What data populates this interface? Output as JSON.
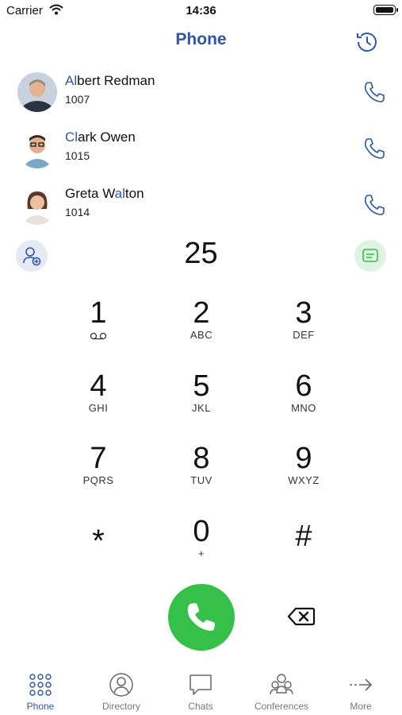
{
  "status": {
    "carrier": "Carrier",
    "time": "14:36"
  },
  "header": {
    "title": "Phone"
  },
  "contacts": [
    {
      "pre": "",
      "hl": "Al",
      "post": "bert Redman",
      "ext": "1007"
    },
    {
      "pre": "",
      "hl": "Cl",
      "post": "ark Owen",
      "ext": "1015"
    },
    {
      "pre": "Greta W",
      "hl": "al",
      "post": "ton",
      "ext": "1014"
    }
  ],
  "dialer": {
    "number": "25"
  },
  "keypad": [
    {
      "digit": "1",
      "letters": ""
    },
    {
      "digit": "2",
      "letters": "ABC"
    },
    {
      "digit": "3",
      "letters": "DEF"
    },
    {
      "digit": "4",
      "letters": "GHI"
    },
    {
      "digit": "5",
      "letters": "JKL"
    },
    {
      "digit": "6",
      "letters": "MNO"
    },
    {
      "digit": "7",
      "letters": "PQRS"
    },
    {
      "digit": "8",
      "letters": "TUV"
    },
    {
      "digit": "9",
      "letters": "WXYZ"
    },
    {
      "digit": "*",
      "letters": ""
    },
    {
      "digit": "0",
      "letters": "+"
    },
    {
      "digit": "#",
      "letters": ""
    }
  ],
  "tabs": [
    {
      "label": "Phone",
      "icon": "keypad-grid-icon"
    },
    {
      "label": "Directory",
      "icon": "person-circle-icon"
    },
    {
      "label": "Chats",
      "icon": "chat-bubble-icon"
    },
    {
      "label": "Conferences",
      "icon": "group-icon"
    },
    {
      "label": "More",
      "icon": "arrow-right-icon"
    }
  ],
  "colors": {
    "accent": "#2d56a5",
    "call_green": "#35c04a"
  }
}
